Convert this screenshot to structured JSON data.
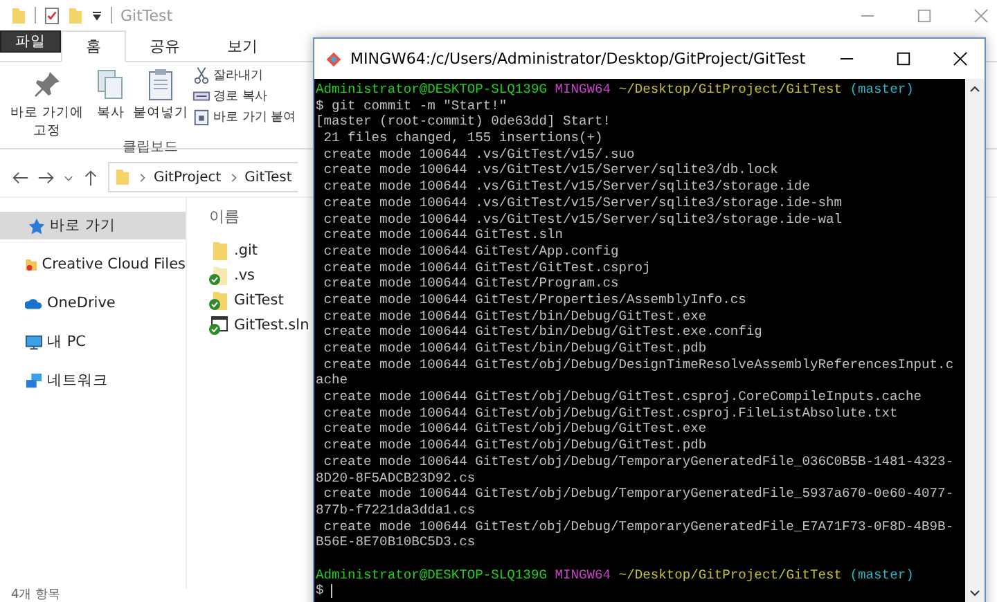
{
  "explorer": {
    "title": "GitTest",
    "ribbon_tabs": [
      {
        "label": "파일",
        "kind": "file"
      },
      {
        "label": "홈",
        "kind": "tab",
        "selected": true
      },
      {
        "label": "공유",
        "kind": "tab",
        "selected": false
      },
      {
        "label": "보기",
        "kind": "tab",
        "selected": false
      }
    ],
    "clipboard": {
      "large": [
        "바로 가기에 고정",
        "복사",
        "붙여넣기"
      ],
      "small": [
        "잘라내기",
        "경로 복사",
        "바로 가기 붙여"
      ],
      "group_label": "클립보드"
    },
    "breadcrumb": [
      "GitProject",
      "GitTest"
    ],
    "sidebar": [
      {
        "label": "바로 가기",
        "selected": true
      },
      {
        "label": "Creative Cloud Files",
        "selected": false
      },
      {
        "label": "OneDrive",
        "selected": false
      },
      {
        "label": "내 PC",
        "selected": false
      },
      {
        "label": "네트워크",
        "selected": false
      }
    ],
    "column_header": "이름",
    "files": [
      {
        "name": ".git",
        "kind": "folder",
        "synced": false
      },
      {
        "name": ".vs",
        "kind": "folder-faded",
        "synced": true
      },
      {
        "name": "GitTest",
        "kind": "folder",
        "synced": true
      },
      {
        "name": "GitTest.sln",
        "kind": "solution",
        "synced": true
      }
    ],
    "status_bar": "4개 항목"
  },
  "terminal": {
    "title": "MINGW64:/c/Users/Administrator/Desktop/GitProject/GitTest",
    "lines": [
      {
        "kind": "prompt",
        "user": "Administrator@DESKTOP-SLQ139G",
        "system": "MINGW64",
        "path": "~/Desktop/GitProject/GitTest",
        "branch": "(master)"
      },
      {
        "kind": "text",
        "text": "$ git commit -m \"Start!\""
      },
      {
        "kind": "text",
        "text": "[master (root-commit) 0de63dd] Start!"
      },
      {
        "kind": "text",
        "text": " 21 files changed, 155 insertions(+)"
      },
      {
        "kind": "text",
        "text": " create mode 100644 .vs/GitTest/v15/.suo"
      },
      {
        "kind": "text",
        "text": " create mode 100644 .vs/GitTest/v15/Server/sqlite3/db.lock"
      },
      {
        "kind": "text",
        "text": " create mode 100644 .vs/GitTest/v15/Server/sqlite3/storage.ide"
      },
      {
        "kind": "text",
        "text": " create mode 100644 .vs/GitTest/v15/Server/sqlite3/storage.ide-shm"
      },
      {
        "kind": "text",
        "text": " create mode 100644 .vs/GitTest/v15/Server/sqlite3/storage.ide-wal"
      },
      {
        "kind": "text",
        "text": " create mode 100644 GitTest.sln"
      },
      {
        "kind": "text",
        "text": " create mode 100644 GitTest/App.config"
      },
      {
        "kind": "text",
        "text": " create mode 100644 GitTest/GitTest.csproj"
      },
      {
        "kind": "text",
        "text": " create mode 100644 GitTest/Program.cs"
      },
      {
        "kind": "text",
        "text": " create mode 100644 GitTest/Properties/AssemblyInfo.cs"
      },
      {
        "kind": "text",
        "text": " create mode 100644 GitTest/bin/Debug/GitTest.exe"
      },
      {
        "kind": "text",
        "text": " create mode 100644 GitTest/bin/Debug/GitTest.exe.config"
      },
      {
        "kind": "text",
        "text": " create mode 100644 GitTest/bin/Debug/GitTest.pdb"
      },
      {
        "kind": "text",
        "text": " create mode 100644 GitTest/obj/Debug/DesignTimeResolveAssemblyReferencesInput.c"
      },
      {
        "kind": "text",
        "text": "ache"
      },
      {
        "kind": "text",
        "text": " create mode 100644 GitTest/obj/Debug/GitTest.csproj.CoreCompileInputs.cache"
      },
      {
        "kind": "text",
        "text": " create mode 100644 GitTest/obj/Debug/GitTest.csproj.FileListAbsolute.txt"
      },
      {
        "kind": "text",
        "text": " create mode 100644 GitTest/obj/Debug/GitTest.exe"
      },
      {
        "kind": "text",
        "text": " create mode 100644 GitTest/obj/Debug/GitTest.pdb"
      },
      {
        "kind": "text",
        "text": " create mode 100644 GitTest/obj/Debug/TemporaryGeneratedFile_036C0B5B-1481-4323-"
      },
      {
        "kind": "text",
        "text": "8D20-8F5ADCB23D92.cs"
      },
      {
        "kind": "text",
        "text": " create mode 100644 GitTest/obj/Debug/TemporaryGeneratedFile_5937a670-0e60-4077-"
      },
      {
        "kind": "text",
        "text": "877b-f7221da3dda1.cs"
      },
      {
        "kind": "text",
        "text": " create mode 100644 GitTest/obj/Debug/TemporaryGeneratedFile_E7A71F73-0F8D-4B9B-"
      },
      {
        "kind": "text",
        "text": "B56E-8E70B10BC5D3.cs"
      },
      {
        "kind": "blank"
      },
      {
        "kind": "prompt",
        "user": "Administrator@DESKTOP-SLQ139G",
        "system": "MINGW64",
        "path": "~/Desktop/GitProject/GitTest",
        "branch": "(master)"
      },
      {
        "kind": "input",
        "text": "$"
      }
    ]
  }
}
